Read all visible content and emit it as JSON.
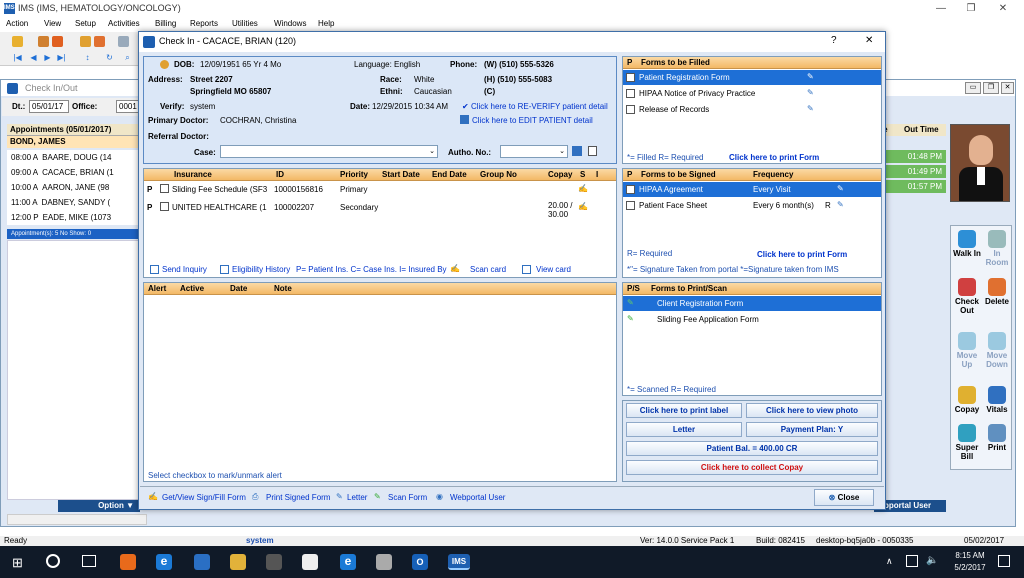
{
  "app": {
    "title": "IMS (IMS, HEMATOLOGY/ONCOLOGY)",
    "menu": [
      "Action",
      "View",
      "Setup",
      "Activities",
      "Billing",
      "Reports",
      "Utilities",
      "Windows",
      "Help"
    ]
  },
  "checkin_window": {
    "title": "Check In/Out",
    "dt_label": "Dt.:",
    "date": "05/01/17",
    "office_label": "Office:",
    "office": "0001",
    "appointments_header": "Appointments (05/01/2017)",
    "provider": "BOND, JAMES",
    "appointments": [
      {
        "time": "08:00 A",
        "name": "BAARE, DOUG (14"
      },
      {
        "time": "09:00 A",
        "name": "CACACE, BRIAN (1"
      },
      {
        "time": "10:00 A",
        "name": "AARON, JANE (98"
      },
      {
        "time": "11:00 A",
        "name": "DABNEY, SANDY ("
      },
      {
        "time": "12:00 P",
        "name": "EADE, MIKE (1073"
      }
    ],
    "appointments_footer": "Appointment(s): 5   No Show: 0",
    "col_me": "me",
    "col_out_time": "Out Time",
    "out_times": [
      "01:48 PM",
      "01:49 PM",
      "01:57 PM"
    ],
    "option_label": "Option",
    "webportal_user": "bportal User"
  },
  "side_buttons": [
    {
      "label": "Walk In",
      "enabled": true
    },
    {
      "label": "In Room",
      "enabled": false
    },
    {
      "label": "Check Out",
      "enabled": true
    },
    {
      "label": "Delete",
      "enabled": true
    },
    {
      "label": "Move Up",
      "enabled": false
    },
    {
      "label": "Move Down",
      "enabled": false
    },
    {
      "label": "Copay",
      "enabled": true
    },
    {
      "label": "Vitals",
      "enabled": true
    },
    {
      "label": "Super Bill",
      "enabled": true
    },
    {
      "label": "Print",
      "enabled": true
    }
  ],
  "dialog": {
    "title": "Check In - CACACE, BRIAN  (120)",
    "help": "?",
    "close": "✕",
    "patient": {
      "dob_label": "DOB:",
      "dob": "12/09/1951  65 Yr 4 Mo",
      "language_label": "Language:",
      "language": "English",
      "phone_label": "Phone:",
      "phone_w": "(W)  (510) 555-5326",
      "address_label": "Address:",
      "address1": "Street 2207",
      "address2": "Springfield  MO  65807",
      "race_label": "Race:",
      "race": "White",
      "phone_h": "(H)  (510) 555-5083",
      "ethni_label": "Ethni:",
      "ethni": "Caucasian",
      "phone_c": "(C)",
      "verify_label": "Verify:",
      "verify": "system",
      "date_label": "Date:",
      "date": "12/29/2015 10:34 AM",
      "reverify_link": "Click here to RE-VERIFY patient detail",
      "primary_doctor_label": "Primary Doctor:",
      "primary_doctor": "COCHRAN, Christina",
      "edit_link": "Click here to EDIT PATIENT detail",
      "referral_label": "Referral Doctor:",
      "case_label": "Case:",
      "autho_label": "Autho. No.:"
    },
    "insurance": {
      "headers": [
        "Insurance",
        "ID",
        "Priority",
        "Start Date",
        "End Date",
        "Group No",
        "Copay",
        "S",
        "I"
      ],
      "rows": [
        {
          "p": "P",
          "insurance": "Sliding Fee Schedule  (SF3",
          "id": "10000156816",
          "priority": "Primary",
          "copay": ""
        },
        {
          "p": "P",
          "insurance": "UNITED HEALTHCARE  (1",
          "id": "100002207",
          "priority": "Secondary",
          "copay": "20.00 / 30.00"
        }
      ],
      "footer": {
        "send_inquiry": "Send Inquiry",
        "eligibility": "Eligibility History",
        "legend": "P= Patient Ins.  C= Case Ins.  I= Insured By",
        "scan_card": "Scan card",
        "view_card": "View card"
      }
    },
    "alerts": {
      "headers": [
        "Alert",
        "Active",
        "Date",
        "Note"
      ],
      "footer": "Select checkbox to mark/unmark alert"
    },
    "forms_filled": {
      "header_p": "P",
      "header": "Forms to be Filled",
      "items": [
        "Patient Registration Form",
        "HIPAA Notice of Privacy Practice",
        "Release of Records"
      ],
      "legend": "*= Filled   R= Required",
      "print_link": "Click here to print Form"
    },
    "forms_signed": {
      "header_p": "P",
      "header": "Forms to be Signed",
      "header_freq": "Frequency",
      "items": [
        {
          "name": "HIPAA Agreement",
          "freq": "Every Visit",
          "r": ""
        },
        {
          "name": "Patient Face Sheet",
          "freq": "Every 6 month(s)",
          "r": "R"
        }
      ],
      "legend1": "R= Required",
      "print_link": "Click here to print Form",
      "legend2": "*\"= Signature Taken from portal   *=Signature taken from IMS"
    },
    "forms_print": {
      "header_p": "P/S",
      "header": "Forms to Print/Scan",
      "items": [
        "Client Registration Form",
        "Sliding Fee Application Form"
      ],
      "legend": "*= Scanned   R= Required"
    },
    "buttons": {
      "print_label": "Click here to print label",
      "view_photo": "Click here to view photo",
      "letter": "Letter",
      "payment_plan": "Payment Plan: Y",
      "patient_bal": "Patient Bal. = 400.00 CR",
      "collect_copay": "Click here to collect Copay"
    },
    "bottom": {
      "get_view_sign": "Get/View Sign/Fill Form",
      "print_signed": "Print Signed Form",
      "letter": "Letter",
      "scan_form": "Scan Form",
      "webportal_user": "Webportal User",
      "close": "Close"
    }
  },
  "status_bar": {
    "ready": "Ready",
    "user": "system",
    "version": "Ver: 14.0.0 Service Pack 1",
    "build": "Build: 082415",
    "machine": "desktop-bq5ja0b - 0050335",
    "date": "05/02/2017"
  },
  "taskbar": {
    "time": "8:15 AM",
    "date": "5/2/2017"
  }
}
